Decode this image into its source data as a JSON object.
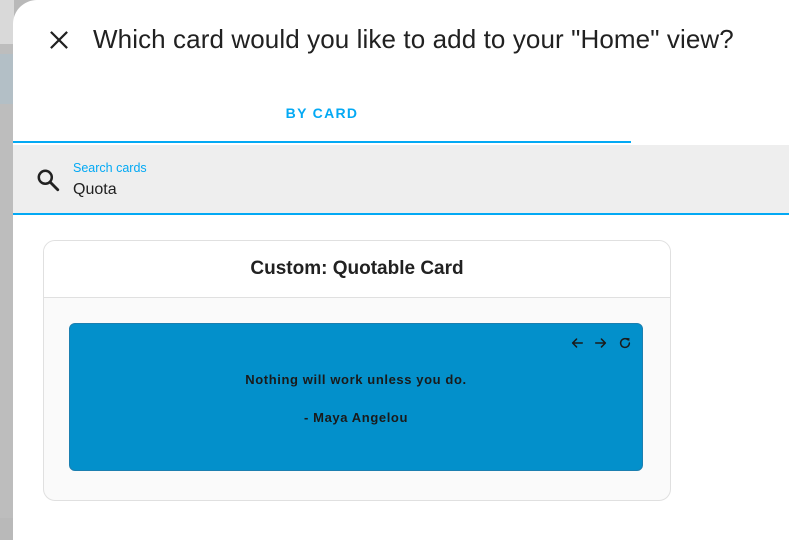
{
  "dialog": {
    "title": "Which card would you like to add to your \"Home\" view?",
    "close_icon": "close-icon"
  },
  "tabs": [
    {
      "label": "BY CARD",
      "active": true
    }
  ],
  "search": {
    "label": "Search cards",
    "value": "Quota",
    "icon": "search-icon"
  },
  "cards": [
    {
      "title": "Custom: Quotable Card",
      "preview": {
        "quote": "Nothing will work unless you do.",
        "author": "- Maya Angelou",
        "icons": [
          "arrow-left-icon",
          "arrow-right-icon",
          "refresh-icon"
        ]
      }
    }
  ],
  "colors": {
    "accent": "#03a9f4",
    "preview_bg": "#0390cb",
    "search_bg": "#eeeeee"
  }
}
